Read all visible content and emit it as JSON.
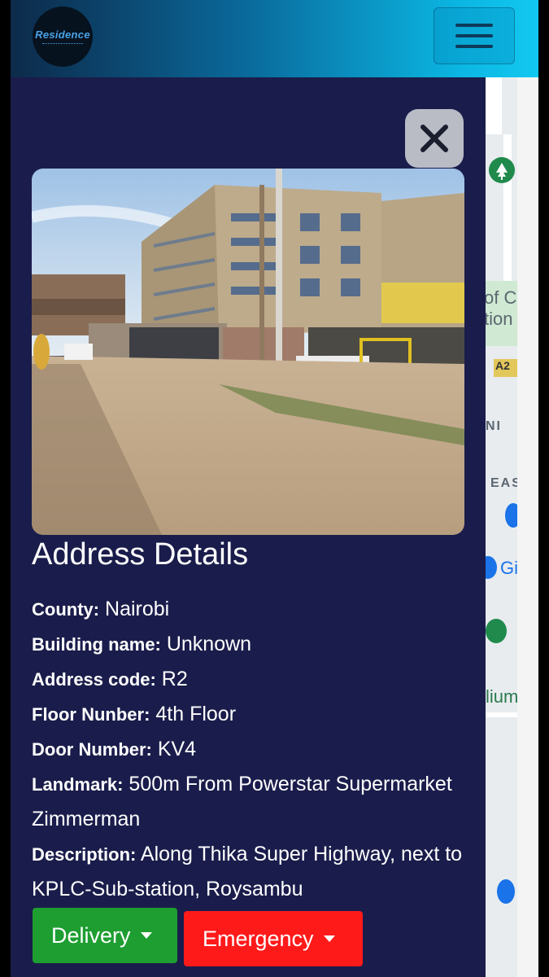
{
  "header": {
    "logo_text": "Residence",
    "menu_icon": "hamburger-menu-icon"
  },
  "modal": {
    "close_icon": "close-icon",
    "title": "Address Details",
    "details": [
      {
        "label": "County:",
        "value": " Nairobi"
      },
      {
        "label": "Building name:",
        "value": " Unknown"
      },
      {
        "label": "Address code:",
        "value": " R2"
      },
      {
        "label": "Floor Nunber:",
        "value": " 4th Floor"
      },
      {
        "label": "Door Number:",
        "value": " KV4"
      },
      {
        "label": "Landmark:",
        "value": " 500m From Powerstar Supermarket Zimmerman"
      },
      {
        "label": "Description:",
        "value": " Along Thika Super Highway, next to KPLC-Sub-station, Roysambu"
      }
    ],
    "buttons": {
      "delivery": "Delivery",
      "emergency": "Emergency"
    }
  },
  "map": {
    "labels": [
      "of C",
      "tion",
      "A2",
      "NI",
      "EAS",
      "Gi",
      "lium"
    ]
  },
  "colors": {
    "panel_bg": "#1a1d4b",
    "delivery_green": "#1e9e31",
    "emergency_red": "#ff1a1a",
    "header_gradient_end": "#12c8f0"
  }
}
